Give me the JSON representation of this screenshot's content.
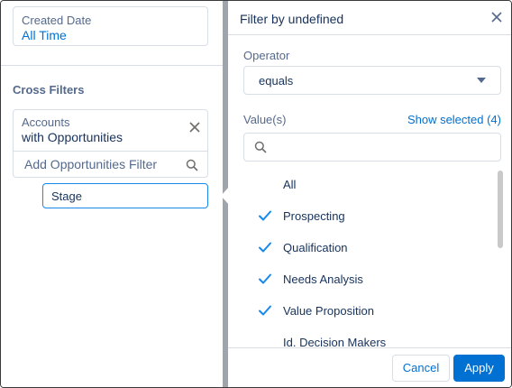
{
  "left_panel": {
    "date_filter": {
      "label": "Created Date",
      "value": "All Time"
    },
    "cross_filters": {
      "title": "Cross Filters",
      "filter": {
        "label": "Accounts",
        "value": "with Opportunities"
      },
      "add_filter_placeholder": "Add Opportunities Filter",
      "stage_field": "Stage"
    }
  },
  "right_panel": {
    "title": "Filter by undefined",
    "operator": {
      "label": "Operator",
      "selected": "equals"
    },
    "values": {
      "label": "Value(s)",
      "show_selected": "Show selected (4)",
      "search_placeholder": ""
    },
    "items": [
      {
        "label": "All",
        "checked": false
      },
      {
        "label": "Prospecting",
        "checked": true
      },
      {
        "label": "Qualification",
        "checked": true
      },
      {
        "label": "Needs Analysis",
        "checked": true
      },
      {
        "label": "Value Proposition",
        "checked": true
      },
      {
        "label": "Id. Decision Makers",
        "checked": false
      }
    ],
    "footer": {
      "cancel": "Cancel",
      "apply": "Apply"
    }
  },
  "colors": {
    "accent": "#0070d2",
    "check": "#1589ee",
    "text": "#16325c",
    "label": "#54698d",
    "splitter": "#a0a5ab"
  },
  "icons": [
    "close-icon",
    "search-icon",
    "dropdown-caret-icon",
    "checkmark-icon"
  ]
}
